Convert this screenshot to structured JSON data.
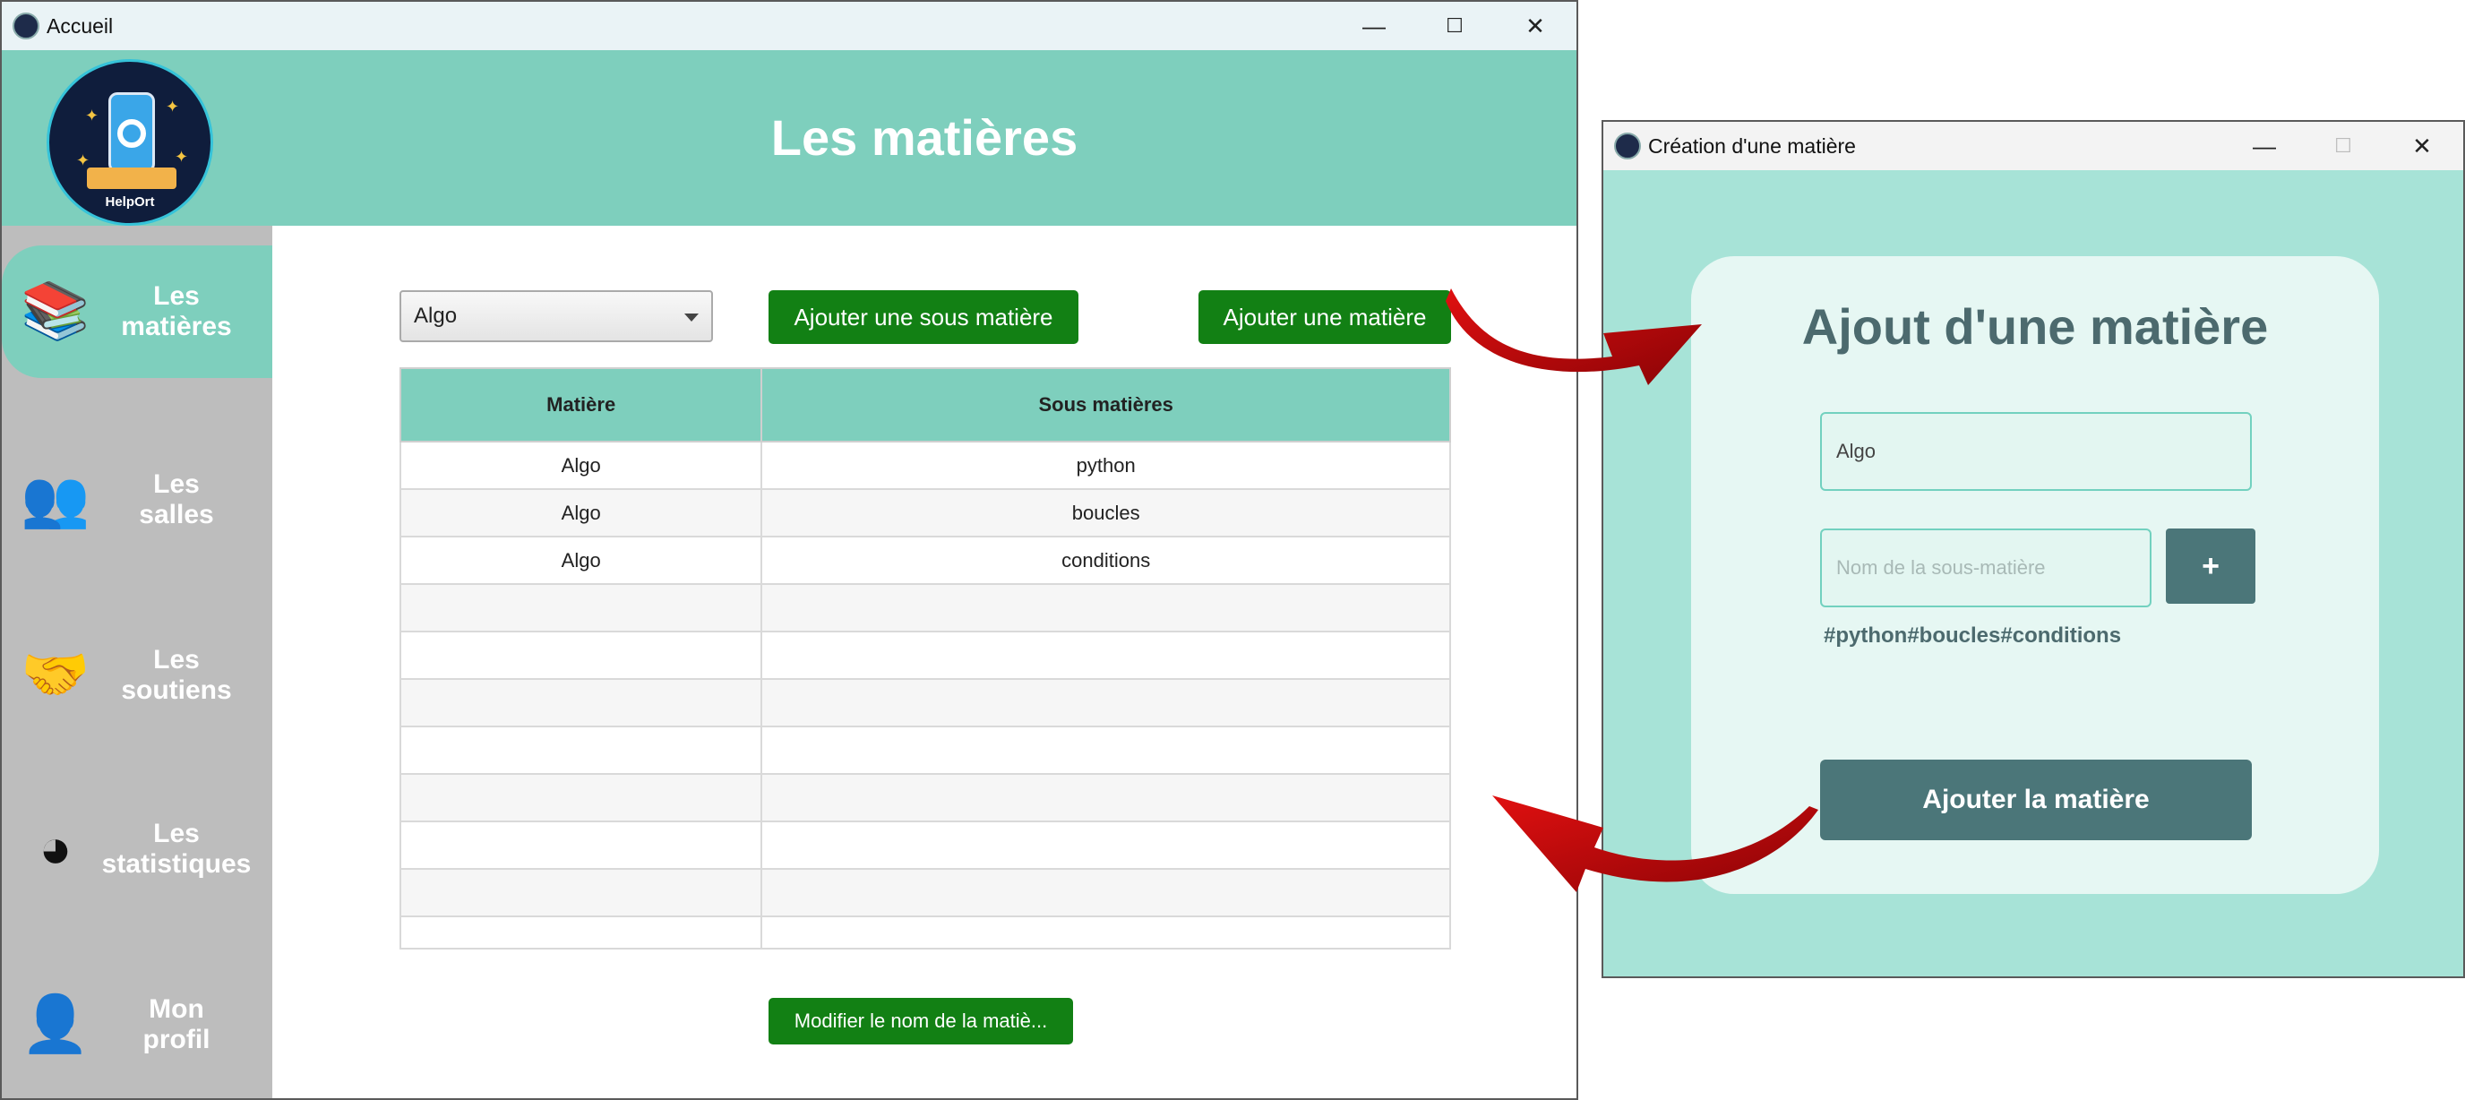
{
  "main_window": {
    "title": "Accueil",
    "controls": {
      "minimize": "—",
      "maximize": "☐",
      "close": "✕"
    },
    "logo": {
      "brand": "HelpOrt"
    },
    "page_title": "Les matières",
    "sidebar": [
      {
        "label": "Les\nmatières",
        "icon": "books-icon",
        "glyph": "📚",
        "active": true
      },
      {
        "label": "Les\nsalles",
        "icon": "classroom-icon",
        "glyph": "👥",
        "active": false
      },
      {
        "label": "Les\nsoutiens",
        "icon": "handshake-icon",
        "glyph": "🤝",
        "active": false
      },
      {
        "label": "Les\nstatistiques",
        "icon": "stats-icon",
        "glyph": "◕",
        "active": false
      },
      {
        "label": "Mon\nprofil",
        "icon": "profile-icon",
        "glyph": "👤",
        "active": false
      }
    ],
    "subject_select": {
      "value": "Algo"
    },
    "add_sub_button": "Ajouter une sous matière",
    "add_subject_button": "Ajouter une matière",
    "table": {
      "columns": [
        "Matière",
        "Sous matières"
      ],
      "rows": [
        [
          "Algo",
          "python"
        ],
        [
          "Algo",
          "boucles"
        ],
        [
          "Algo",
          "conditions"
        ]
      ]
    },
    "rename_button": "Modifier le nom de la matiè..."
  },
  "dialog_window": {
    "title": "Création d'une matière",
    "controls": {
      "minimize": "—",
      "maximize": "☐",
      "close": "✕"
    },
    "heading": "Ajout d'une matière",
    "subject_field": {
      "value": "Algo"
    },
    "sub_field": {
      "placeholder": "Nom de la sous-matière"
    },
    "plus_button": "+",
    "tags": "#python#boucles#conditions",
    "submit_button": "Ajouter la matière"
  },
  "colors": {
    "header": "#7ecfbd",
    "sidebar": "#bdbdbd",
    "green_button": "#128014",
    "dialog_bg": "#a7e3d7",
    "dialog_button": "#4b7679",
    "arrow": "#c0090b"
  }
}
